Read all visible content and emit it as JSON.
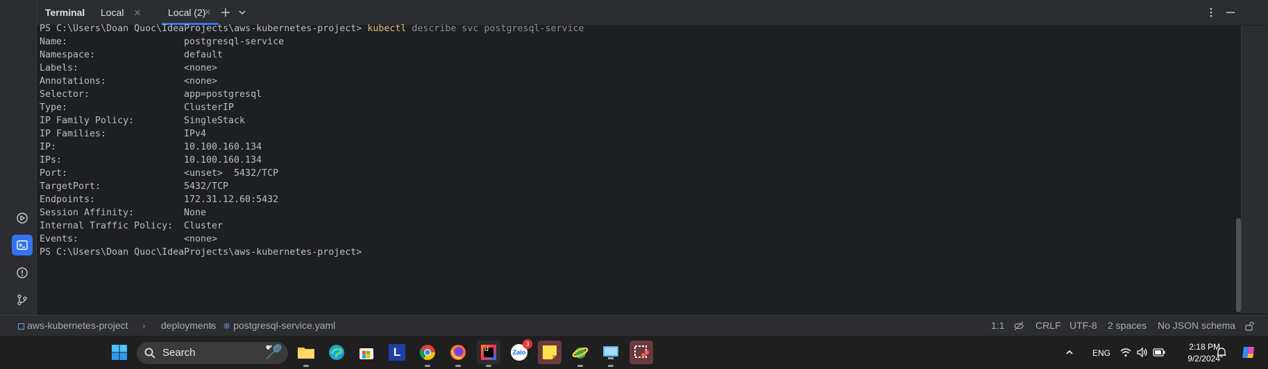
{
  "terminal_panel": {
    "title": "Terminal",
    "tabs": [
      {
        "label": "Local"
      },
      {
        "label": "Local (2)",
        "active": true
      }
    ]
  },
  "terminal": {
    "prompt_line": {
      "prompt": "PS C:\\Users\\Doan Quoc\\IdeaProjects\\aws-kubernetes-project> ",
      "command": "kubectl",
      "args": " describe svc postgresql-service"
    },
    "output": [
      {
        "key": "Name:",
        "value": "postgresql-service"
      },
      {
        "key": "Namespace:",
        "value": "default"
      },
      {
        "key": "Labels:",
        "value": "<none>"
      },
      {
        "key": "Annotations:",
        "value": "<none>"
      },
      {
        "key": "Selector:",
        "value": "app=postgresql"
      },
      {
        "key": "Type:",
        "value": "ClusterIP"
      },
      {
        "key": "IP Family Policy:",
        "value": "SingleStack"
      },
      {
        "key": "IP Families:",
        "value": "IPv4"
      },
      {
        "key": "IP:",
        "value": "10.100.160.134"
      },
      {
        "key": "IPs:",
        "value": "10.100.160.134"
      },
      {
        "key": "Port:",
        "value": "<unset>  5432/TCP"
      },
      {
        "key": "TargetPort:",
        "value": "5432/TCP"
      },
      {
        "key": "Endpoints:",
        "value": "172.31.12.60:5432"
      },
      {
        "key": "Session Affinity:",
        "value": "None"
      },
      {
        "key": "Internal Traffic Policy:",
        "value": "Cluster"
      },
      {
        "key": "Events:",
        "value": "<none>"
      }
    ],
    "final_prompt": "PS C:\\Users\\Doan Quoc\\IdeaProjects\\aws-kubernetes-project>"
  },
  "breadcrumb": {
    "project": "aws-kubernetes-project",
    "folder": "deployments",
    "file": "postgresql-service.yaml"
  },
  "status": {
    "position": "1:1",
    "line_ending": "CRLF",
    "encoding": "UTF-8",
    "indent": "2 spaces",
    "schema": "No JSON schema"
  },
  "taskbar": {
    "search_label": "Search",
    "zalo_badge": "3",
    "language": "ENG",
    "time": "2:18 PM",
    "date": "9/2/2024"
  },
  "colors": {
    "accent": "#3574f0",
    "command": "#e5c07b"
  }
}
